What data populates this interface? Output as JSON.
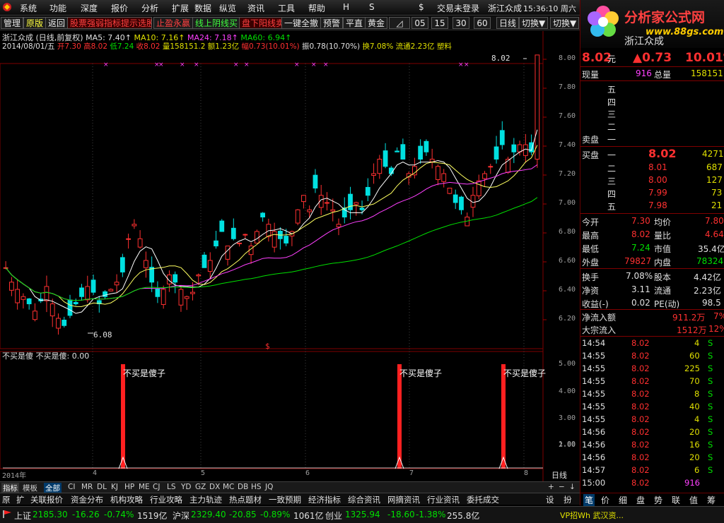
{
  "menu": [
    "系统",
    "功能",
    "深度",
    "报价",
    "分析",
    "扩展",
    "数据",
    "纵览",
    "资讯",
    "工具",
    "帮助",
    "H",
    "S",
    "$",
    "交易未登录",
    "浙江众成",
    "15:36:10 周六"
  ],
  "toolbar": {
    "items": [
      "管理",
      "原版",
      "返回",
      "股票强弱指标提示选股",
      "止盈永赢",
      "线上阴线买",
      "盘下阳线卖",
      "一键全撤",
      "预警",
      "平直",
      "黄金",
      "◿",
      "05",
      "15",
      "30",
      "60",
      "日线",
      "切换▼",
      "切换▼"
    ]
  },
  "logo": {
    "title": "分析家公式网",
    "url": "www.88gs.com",
    "stock": "浙江众成"
  },
  "chart": {
    "title_line": "浙江众成 (日线,前复权) MA5: 7.40↑ MA10: 7.16↑ MA24: 7.18↑ MA60: 6.94↑",
    "ma5_label": "MA5: 7.40↑",
    "ma10_label": "MA10: 7.16↑",
    "ma24_label": "MA24: 7.18↑",
    "ma60_label": "MA60: 6.94↑",
    "name_label": "浙江众成 (日线,前复权)",
    "bar_info": {
      "date": "2014/08/01/五",
      "open": "开7.30",
      "high": "高8.02",
      "low": "低7.24",
      "close": "收8.02",
      "vol": "量158151.2",
      "amount": "额1.23亿",
      "pct": "幅0.73(10.01%)",
      "amp": "振0.78(10.70%)",
      "turnover": "换7.08%",
      "float": "流通2.23亿",
      "industry": "塑料"
    },
    "price_axis": [
      "8.00",
      "7.80",
      "7.60",
      "7.40",
      "7.20",
      "7.00",
      "6.80",
      "6.60",
      "6.40",
      "6.20"
    ],
    "high_marker": "8.02",
    "low_marker": "6.08",
    "indicator_title": "不买是傻 不买是傻: 0.00",
    "indicator_axis": [
      "5.00",
      "4.00",
      "3.00",
      "2.00",
      "1.00"
    ],
    "signal_label": "不买是傻子",
    "date_axis": [
      "2014年",
      "4",
      "5",
      "6",
      "7",
      "8"
    ],
    "period": "日线",
    "dollar": "$"
  },
  "bottom_tabs": [
    "指标",
    "模板",
    "全部",
    "CI",
    "MR",
    "DL",
    "KJ",
    "HP",
    "ME",
    "CJ",
    "LS",
    "YD",
    "GZ",
    "DX",
    "MC",
    "DB",
    "HS",
    "JQ"
  ],
  "bottom_tabs2": [
    "原",
    "扩",
    "关联报价",
    "资金分布",
    "机构攻略",
    "行业攻略",
    "主力轨迹",
    "热点题材",
    "一致预期",
    "经济指标",
    "综合资讯",
    "网摘资讯",
    "行业资讯",
    "委托成交"
  ],
  "bottom_right": [
    "设",
    "扮"
  ],
  "status": {
    "sh": {
      "name": "上证",
      "val": "2185.30",
      "chg": "-16.26",
      "pct": "-0.74%",
      "amt": "1519亿"
    },
    "sz": {
      "name": "沪深",
      "val": "2329.40",
      "chg": "-20.85",
      "pct": "-0.89%",
      "amt": "1061亿"
    },
    "cy": {
      "name": "创业",
      "val": "1325.94",
      "chg": "-18.60",
      "pct": "-1.38%",
      "amt": "255.8亿"
    },
    "extra": "VP招Wh 武汉资..."
  },
  "quote": {
    "price": "8.02",
    "unit": "元",
    "chg": "▲0.73",
    "pct": "10.01%",
    "now_vol_label": "现量",
    "now_vol": "916",
    "total_vol_label": "总量",
    "total_vol": "158151",
    "ask_labels": [
      "五",
      "四",
      "三",
      "二",
      "一"
    ],
    "ask_title": "卖盘",
    "bid_title": "买盘",
    "bids": [
      {
        "lvl": "一",
        "price": "8.02",
        "vol": "4271"
      },
      {
        "lvl": "二",
        "price": "8.01",
        "vol": "687"
      },
      {
        "lvl": "三",
        "price": "8.00",
        "vol": "127"
      },
      {
        "lvl": "四",
        "price": "7.99",
        "vol": "73"
      },
      {
        "lvl": "五",
        "price": "7.98",
        "vol": "21"
      }
    ],
    "stats": [
      {
        "l1": "今开",
        "v1": "7.30",
        "l2": "均价",
        "v2": "7.80"
      },
      {
        "l1": "最高",
        "v1": "8.02",
        "l2": "量比",
        "v2": "4.64"
      },
      {
        "l1": "最低",
        "v1": "7.24",
        "l2": "市值",
        "v2": "35.4亿"
      },
      {
        "l1": "外盘",
        "v1": "79827",
        "l2": "内盘",
        "v2": "78324"
      }
    ],
    "stats2": [
      {
        "l1": "换手",
        "v1": "7.08%",
        "l2": "股本",
        "v2": "4.42亿"
      },
      {
        "l1": "净资",
        "v1": "3.11",
        "l2": "流通",
        "v2": "2.23亿"
      },
      {
        "l1": "收益(-)",
        "v1": "0.02",
        "l2": "PE(动)",
        "v2": "98.5"
      }
    ],
    "flow": [
      {
        "l": "净流入额",
        "v": "911.2万",
        "p": "7%"
      },
      {
        "l": "大宗流入",
        "v": "1512万",
        "p": "12%"
      }
    ],
    "ticks": [
      {
        "t": "14:54",
        "p": "8.02",
        "v": "4",
        "s": "S"
      },
      {
        "t": "14:55",
        "p": "8.02",
        "v": "60",
        "s": "S"
      },
      {
        "t": "14:55",
        "p": "8.02",
        "v": "225",
        "s": "S"
      },
      {
        "t": "14:55",
        "p": "8.02",
        "v": "70",
        "s": "S"
      },
      {
        "t": "14:55",
        "p": "8.02",
        "v": "8",
        "s": "S"
      },
      {
        "t": "14:55",
        "p": "8.02",
        "v": "40",
        "s": "S"
      },
      {
        "t": "14:55",
        "p": "8.02",
        "v": "4",
        "s": "S"
      },
      {
        "t": "14:56",
        "p": "8.02",
        "v": "20",
        "s": "S"
      },
      {
        "t": "14:56",
        "p": "8.02",
        "v": "16",
        "s": "S"
      },
      {
        "t": "14:56",
        "p": "8.02",
        "v": "20",
        "s": "S"
      },
      {
        "t": "14:57",
        "p": "8.02",
        "v": "6",
        "s": "S"
      },
      {
        "t": "15:00",
        "p": "8.02",
        "v": "916",
        "s": ""
      }
    ],
    "tick_tabs": [
      "笔",
      "价",
      "细",
      "盘",
      "势",
      "联",
      "值",
      "筹"
    ]
  },
  "colors": {
    "up": "#ff3030",
    "down": "#00e0e0",
    "ma5": "#ffffff",
    "ma10": "#ffff60",
    "ma24": "#ff40ff",
    "ma60": "#00e000"
  }
}
